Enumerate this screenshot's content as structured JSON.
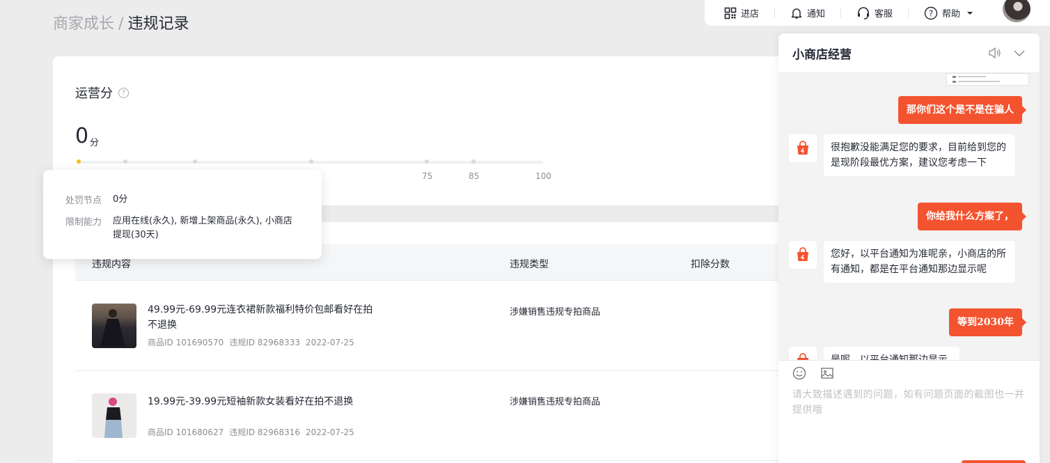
{
  "breadcrumb": {
    "parent": "商家成长",
    "separator": "/",
    "current": "违规记录"
  },
  "topbar": {
    "items": [
      {
        "label": "进店",
        "icon": "qrcode-icon"
      },
      {
        "label": "通知",
        "icon": "bell-icon"
      },
      {
        "label": "客服",
        "icon": "headset-icon"
      },
      {
        "label": "帮助",
        "icon": "question-circle-icon"
      }
    ]
  },
  "score": {
    "title": "运营分",
    "value": "0",
    "unit": "分",
    "progress_value": 0,
    "ticks": [
      "75",
      "85",
      "100"
    ]
  },
  "tooltip": {
    "node_label": "处罚节点",
    "node_value": "0分",
    "limit_label": "限制能力",
    "limit_value": "应用在线(永久), 新增上架商品(永久), 小商店提现(30天)"
  },
  "table": {
    "headers": {
      "content": "违规内容",
      "type": "违规类型",
      "deduct": "扣除分数"
    },
    "rows": [
      {
        "title": "49.99元-69.99元连衣裙新款福利特价包邮看好在拍不退换",
        "product_id": "商品ID 101690570",
        "violation_id": "违规ID 82968333",
        "date": "2022-07-25",
        "type": "涉嫌销售违规专拍商品"
      },
      {
        "title": "19.99元-39.99元短袖新款女装看好在拍不退换",
        "product_id": "商品ID 101680627",
        "violation_id": "违规ID 82968316",
        "date": "2022-07-25",
        "type": "涉嫌销售违规专拍商品"
      }
    ]
  },
  "chat": {
    "title": "小商店经营",
    "messages": [
      {
        "side": "right",
        "text": "那你们这个是不是在骗人"
      },
      {
        "side": "left",
        "text": "很抱歉没能满足您的要求，目前给到您的是现阶段最优方案，建议您考虑一下"
      },
      {
        "side": "right",
        "text": "你给我什么方案了，"
      },
      {
        "side": "left",
        "text": "您好，以平台通知为准呢亲，小商店的所有通知，都是在平台通知那边显示呢"
      },
      {
        "side": "right",
        "text": "等到2030年"
      },
      {
        "side": "left",
        "text": "是呢，以平台通知那边显示的为准哦"
      }
    ],
    "input_placeholder": "请大致描述遇到的问题，如有问题页面的截图也一并提供哦"
  },
  "colors": {
    "accent": "#f4532f",
    "score_dot": "#f6c21d"
  }
}
